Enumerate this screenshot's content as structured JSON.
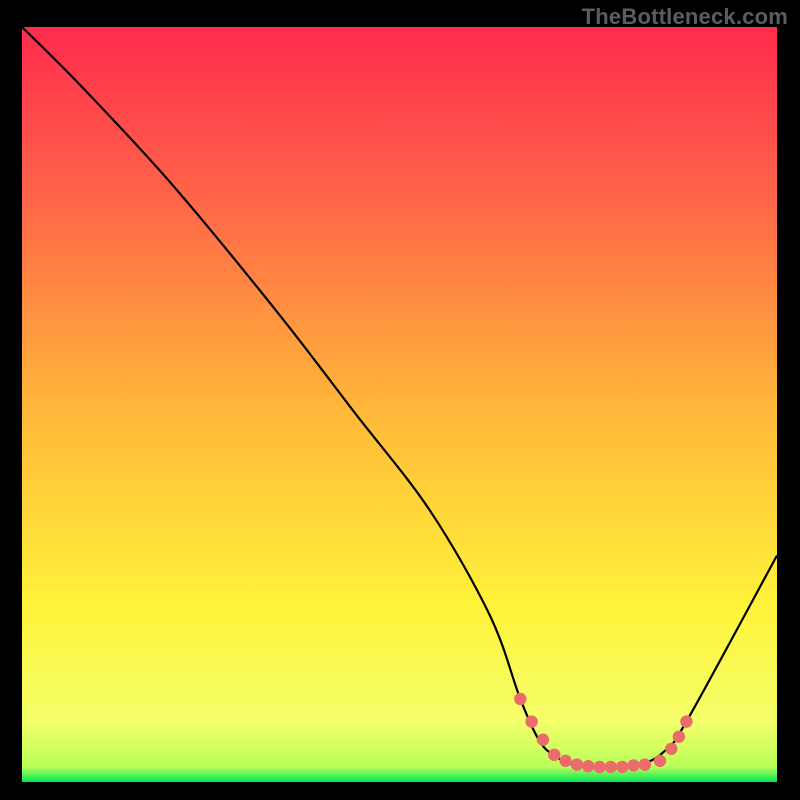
{
  "watermark": "TheBottleneck.com",
  "colors": {
    "page_bg": "#000000",
    "plot_bg_top": "#ff2b4e",
    "plot_bg_upper": "#ff6348",
    "plot_bg_mid": "#ffb63a",
    "plot_bg_lower": "#fff33a",
    "plot_bg_low2": "#f4ff6a",
    "plot_bg_bottom": "#00e756",
    "curve": "#000000",
    "dots": "#ec6b6b"
  },
  "chart_data": {
    "type": "line",
    "title": "",
    "xlabel": "",
    "ylabel": "",
    "xlim": [
      0,
      100
    ],
    "ylim": [
      0,
      100
    ],
    "series": [
      {
        "name": "bottleneck-curve",
        "x": [
          0,
          8,
          20,
          34,
          44,
          54,
          62,
          66,
          68.5,
          70.5,
          73,
          76,
          79,
          82,
          85,
          88,
          100
        ],
        "values": [
          100,
          92,
          79,
          62,
          49,
          36,
          22,
          11,
          5.5,
          3.5,
          2.3,
          2.0,
          2.0,
          2.3,
          4.0,
          8,
          30
        ]
      }
    ],
    "markers": {
      "name": "highlight-dots",
      "x": [
        66,
        67.5,
        69,
        70.5,
        72,
        73.5,
        75,
        76.5,
        78,
        79.5,
        81,
        82.5,
        84.5,
        86,
        87,
        88
      ],
      "values": [
        11,
        8,
        5.6,
        3.6,
        2.8,
        2.3,
        2.1,
        2.0,
        2.0,
        2.0,
        2.2,
        2.3,
        2.8,
        4.4,
        6.0,
        8.0
      ]
    },
    "gradient_stops": [
      {
        "offset": 0,
        "color": "#ff2b4e"
      },
      {
        "offset": 22,
        "color": "#ff6348"
      },
      {
        "offset": 50,
        "color": "#ffb63a"
      },
      {
        "offset": 77,
        "color": "#fff33a"
      },
      {
        "offset": 92,
        "color": "#f4ff6a"
      },
      {
        "offset": 98,
        "color": "#b8ff5a"
      },
      {
        "offset": 100,
        "color": "#00e756"
      }
    ]
  }
}
